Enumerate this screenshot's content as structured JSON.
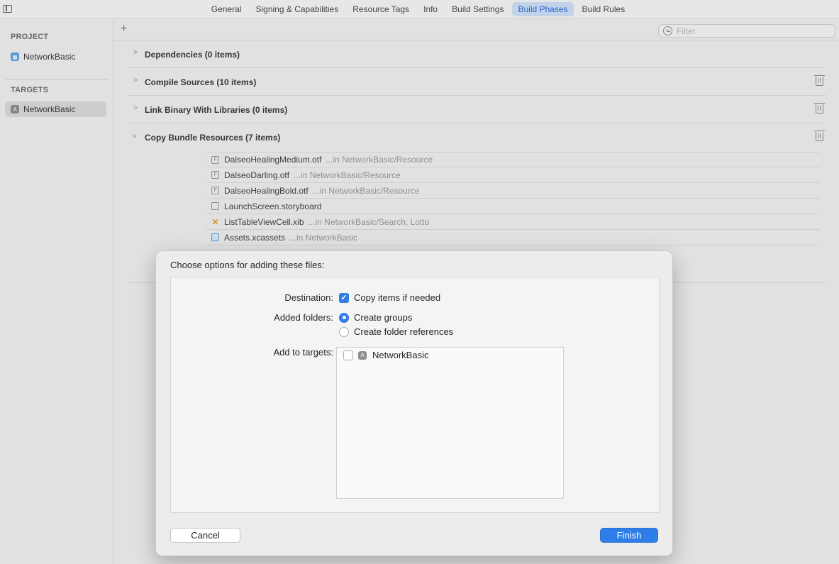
{
  "tabs": [
    {
      "label": "General",
      "selected": false
    },
    {
      "label": "Signing & Capabilities",
      "selected": false
    },
    {
      "label": "Resource Tags",
      "selected": false
    },
    {
      "label": "Info",
      "selected": false
    },
    {
      "label": "Build Settings",
      "selected": false
    },
    {
      "label": "Build Phases",
      "selected": true
    },
    {
      "label": "Build Rules",
      "selected": false
    }
  ],
  "navigator": {
    "project_heading": "PROJECT",
    "project_item": "NetworkBasic",
    "targets_heading": "TARGETS",
    "target_item": "NetworkBasic"
  },
  "toolbar": {
    "add_label": "+",
    "filter_placeholder": "Filter"
  },
  "phases": [
    {
      "title": "Dependencies (0 items)",
      "expanded": false,
      "deletable": false
    },
    {
      "title": "Compile Sources (10 items)",
      "expanded": false,
      "deletable": true
    },
    {
      "title": "Link Binary With Libraries (0 items)",
      "expanded": false,
      "deletable": true
    },
    {
      "title": "Copy Bundle Resources (7 items)",
      "expanded": true,
      "deletable": true
    }
  ],
  "files": [
    {
      "name": "DalseoHealingMedium.otf",
      "path": "...in NetworkBasic/Resource",
      "icon": "font-file-icon"
    },
    {
      "name": "DalseoDarling.otf",
      "path": "...in NetworkBasic/Resource",
      "icon": "font-file-icon"
    },
    {
      "name": "DalseoHealingBold.otf",
      "path": "...in NetworkBasic/Resource",
      "icon": "font-file-icon"
    },
    {
      "name": "LaunchScreen.storyboard",
      "path": "",
      "icon": "document-icon"
    },
    {
      "name": "ListTableViewCell.xib",
      "path": "...in NetworkBasic/Search, Lotto",
      "icon": "xib-icon"
    },
    {
      "name": "Assets.xcassets",
      "path": "...in NetworkBasic",
      "icon": "assets-icon"
    }
  ],
  "dialog": {
    "title": "Choose options for adding these files:",
    "destination_label": "Destination:",
    "destination_option": "Copy items if needed",
    "destination_checked": true,
    "folders_label": "Added folders:",
    "folders_option_1": "Create groups",
    "folders_option_2": "Create folder references",
    "folders_selected": "Create groups",
    "targets_label": "Add to targets:",
    "target_name": "NetworkBasic",
    "target_checked": false,
    "cancel_label": "Cancel",
    "finish_label": "Finish"
  },
  "colors": {
    "accent": "#2f7de8",
    "selected_tab_bg": "#cfe0f7",
    "selected_tab_text": "#2d6ed7"
  }
}
